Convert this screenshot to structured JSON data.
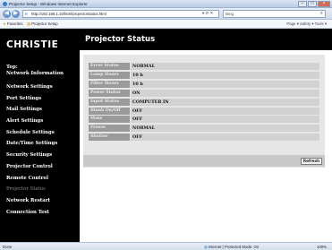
{
  "browser": {
    "window_title": "Projector Setup - Windows Internet Explorer",
    "url": "http://192.168.1.10/html/projectorstatus.html",
    "search_engine": "Bing",
    "favorites": [
      {
        "label": "Favorites"
      },
      {
        "label": "Projector Setup"
      }
    ],
    "tools_text": "Page ▾  Safety ▾  Tools ▾",
    "status_left": "Done",
    "status_zone": "Internet | Protected Mode: On",
    "zoom": "100%"
  },
  "sidebar": {
    "logo": "CHRISTIE",
    "top_link": [
      "Top:",
      "Network Information"
    ],
    "items": [
      {
        "label": "Network Settings",
        "active": false
      },
      {
        "label": "Port Settings",
        "active": false
      },
      {
        "label": "Mail Settings",
        "active": false
      },
      {
        "label": "Alert Settings",
        "active": false
      },
      {
        "label": "Schedule Settings",
        "active": false
      },
      {
        "label": "Date/Time Settings",
        "active": false
      },
      {
        "label": "Security Settings",
        "active": false
      },
      {
        "label": "Projector Control",
        "active": false
      },
      {
        "label": "Remote Control",
        "active": false
      },
      {
        "label": "Projector Status",
        "active": true
      },
      {
        "label": "Network Restart",
        "active": false
      },
      {
        "label": "Connection Test",
        "active": false
      }
    ]
  },
  "main": {
    "title": "Projector Status",
    "status_rows": [
      {
        "label": "Error Status",
        "value": "NORMAL"
      },
      {
        "label": "Lamp Hours",
        "value": "10 h"
      },
      {
        "label": "Filter Hours",
        "value": "10 h"
      },
      {
        "label": "Power Status",
        "value": "ON"
      },
      {
        "label": "Input Status",
        "value": "COMPUTER IN"
      },
      {
        "label": "Blank On/Off",
        "value": "OFF"
      },
      {
        "label": "Mute",
        "value": "OFF"
      },
      {
        "label": "Freeze",
        "value": "NORMAL"
      },
      {
        "label": "Shutter",
        "value": "OFF"
      }
    ],
    "refresh_label": "Refresh"
  }
}
